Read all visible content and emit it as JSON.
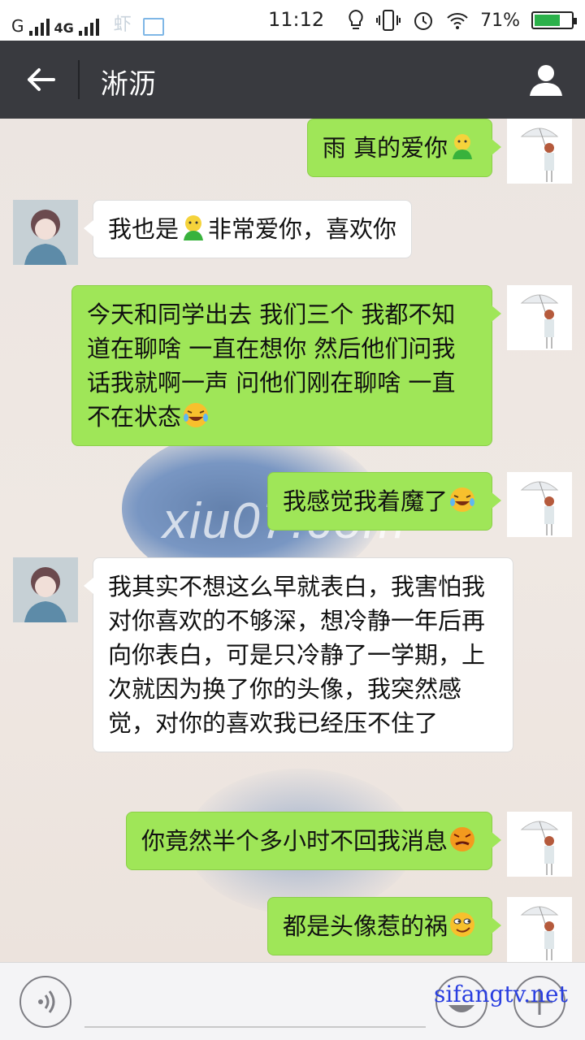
{
  "status_bar": {
    "carrier1": "G",
    "carrier2": "4G",
    "app_icon": "虾",
    "time": "11:12",
    "battery": "71%",
    "battery_level": 0.71,
    "icons": [
      "signal-icon",
      "shrimp-app-icon",
      "image-notification-icon",
      "bulb-icon",
      "vibrate-icon",
      "alarm-icon",
      "wifi-icon",
      "battery-icon"
    ]
  },
  "header": {
    "title": "淅沥"
  },
  "watermark": "xiu07.com",
  "messages": [
    {
      "side": "me",
      "text": "雨 真的爱你",
      "emoji": "green-smiley"
    },
    {
      "side": "other",
      "text": "我也是",
      "emoji": "green-smiley",
      "text_after": "非常爱你，喜欢你"
    },
    {
      "side": "me",
      "text": "今天和同学出去 我们三个 我都不知道在聊啥 一直在想你 然后他们问我话我就啊一声 问他们刚在聊啥 一直不在状态",
      "emoji": "laugh-cry"
    },
    {
      "side": "me",
      "text": "我感觉我着魔了",
      "emoji": "laugh-cry"
    },
    {
      "side": "other",
      "text": "我其实不想这么早就表白，我害怕我对你喜欢的不够深，想冷静一年后再向你表白，可是只冷静了一学期，上次就因为换了你的头像，我突然感觉，对你的喜欢我已经压不住了"
    },
    {
      "side": "me",
      "text": "你竟然半个多小时不回我消息",
      "emoji": "angry"
    },
    {
      "side": "me",
      "text": "都是头像惹的祸",
      "emoji": "smirk"
    }
  ],
  "bottom": {
    "input_placeholder": "",
    "site_mark": "sifangtv.net"
  }
}
